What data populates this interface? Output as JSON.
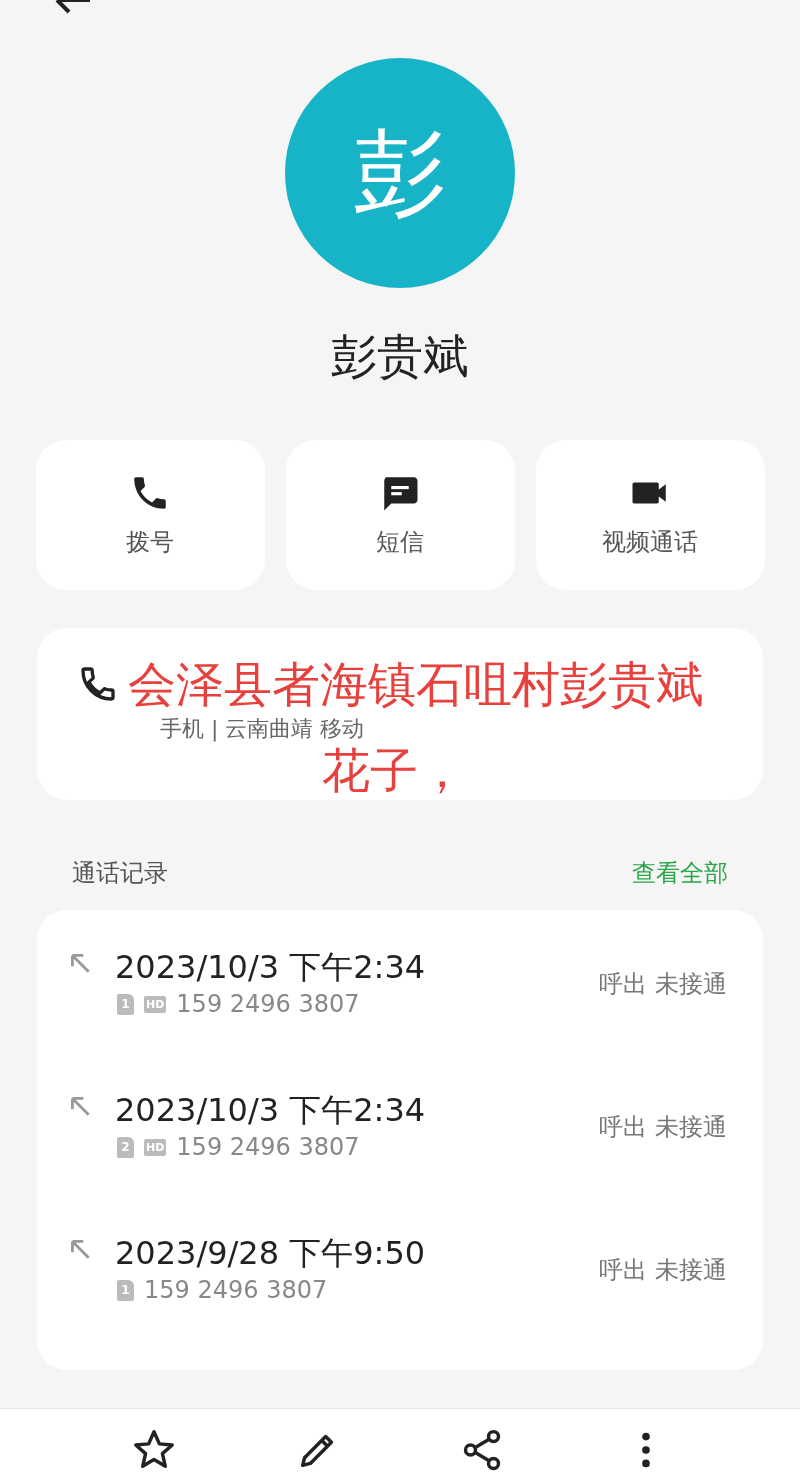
{
  "contact": {
    "avatar_letter": "彭",
    "name": "彭贵斌"
  },
  "actions": [
    {
      "kind": "call",
      "label": "拨号"
    },
    {
      "kind": "message",
      "label": "短信"
    },
    {
      "kind": "video",
      "label": "视频通话"
    }
  ],
  "phone": {
    "detail": "手机 | 云南曲靖 移动"
  },
  "annotation": {
    "lines": [
      "会泽县者海镇石咀村彭贵斌",
      "花子，"
    ]
  },
  "call_log": {
    "title": "通话记录",
    "view_all": "查看全部",
    "rows": [
      {
        "time": "2023/10/3 下午2:34",
        "sim": "1",
        "hd_badge": "HD",
        "number": "159 2496 3807",
        "status": "呼出 未接通"
      },
      {
        "time": "2023/10/3 下午2:34",
        "sim": "2",
        "hd_badge": "HD",
        "number": "159 2496 3807",
        "status": "呼出 未接通"
      },
      {
        "time": "2023/9/28 下午9:50",
        "sim": "1",
        "number": "159 2496 3807",
        "status": "呼出 未接通"
      }
    ]
  },
  "bottom_bar": [
    {
      "kind": "star"
    },
    {
      "kind": "edit"
    },
    {
      "kind": "share"
    },
    {
      "kind": "more"
    }
  ]
}
